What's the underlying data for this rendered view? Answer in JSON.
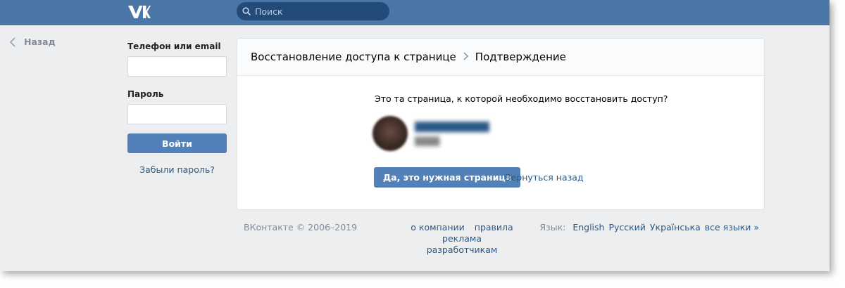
{
  "header": {
    "logo": "vk-logo",
    "search": {
      "placeholder": "Поиск"
    }
  },
  "nav": {
    "back_label": "Назад"
  },
  "login": {
    "phone_label": "Телефон или email",
    "phone_value": "",
    "password_label": "Пароль",
    "password_value": "",
    "submit_label": "Войти",
    "forgot_label": "Забыли пароль?"
  },
  "card": {
    "breadcrumb": [
      "Восстановление доступа к странице",
      "Подтверждение"
    ],
    "question": "Это та страница, к которой необходимо восстановить доступ?",
    "confirm_label": "Да, это нужная страница",
    "back_link": "Вернуться назад"
  },
  "footer": {
    "copyright": "ВКонтакте © 2006–2019",
    "links": [
      "о компании",
      "правила",
      "реклама",
      "разработчикам"
    ],
    "lang_label": "Язык:",
    "languages": [
      "English",
      "Русский",
      "Українська",
      "все языки »"
    ]
  },
  "colors": {
    "brand": "#4a76a8",
    "button": "#5181b8",
    "link": "#2a5885",
    "page_bg": "#edeef0"
  }
}
